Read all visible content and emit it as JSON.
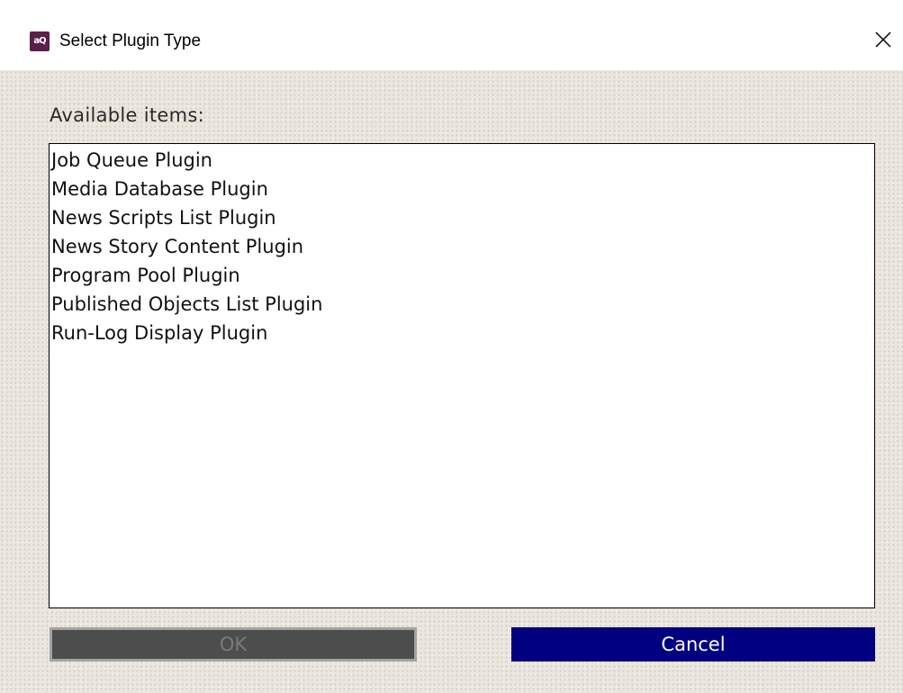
{
  "window": {
    "title": "Select Plugin Type",
    "app_icon_text": "aQ",
    "close_icon": "close-icon"
  },
  "dialog": {
    "list_label": "Available items:",
    "items": [
      "Job Queue Plugin",
      "Media Database Plugin",
      "News Scripts List Plugin",
      "News Story Content Plugin",
      "Program Pool Plugin",
      "Published Objects List Plugin",
      "Run-Log Display Plugin"
    ],
    "ok_label": "OK",
    "cancel_label": "Cancel"
  },
  "colors": {
    "cancel_button_bg": "#000080",
    "ok_button_bg_disabled": "#4d4d4d",
    "dialog_bg": "#ebe6de",
    "app_icon_bg": "#5a1f4a"
  }
}
